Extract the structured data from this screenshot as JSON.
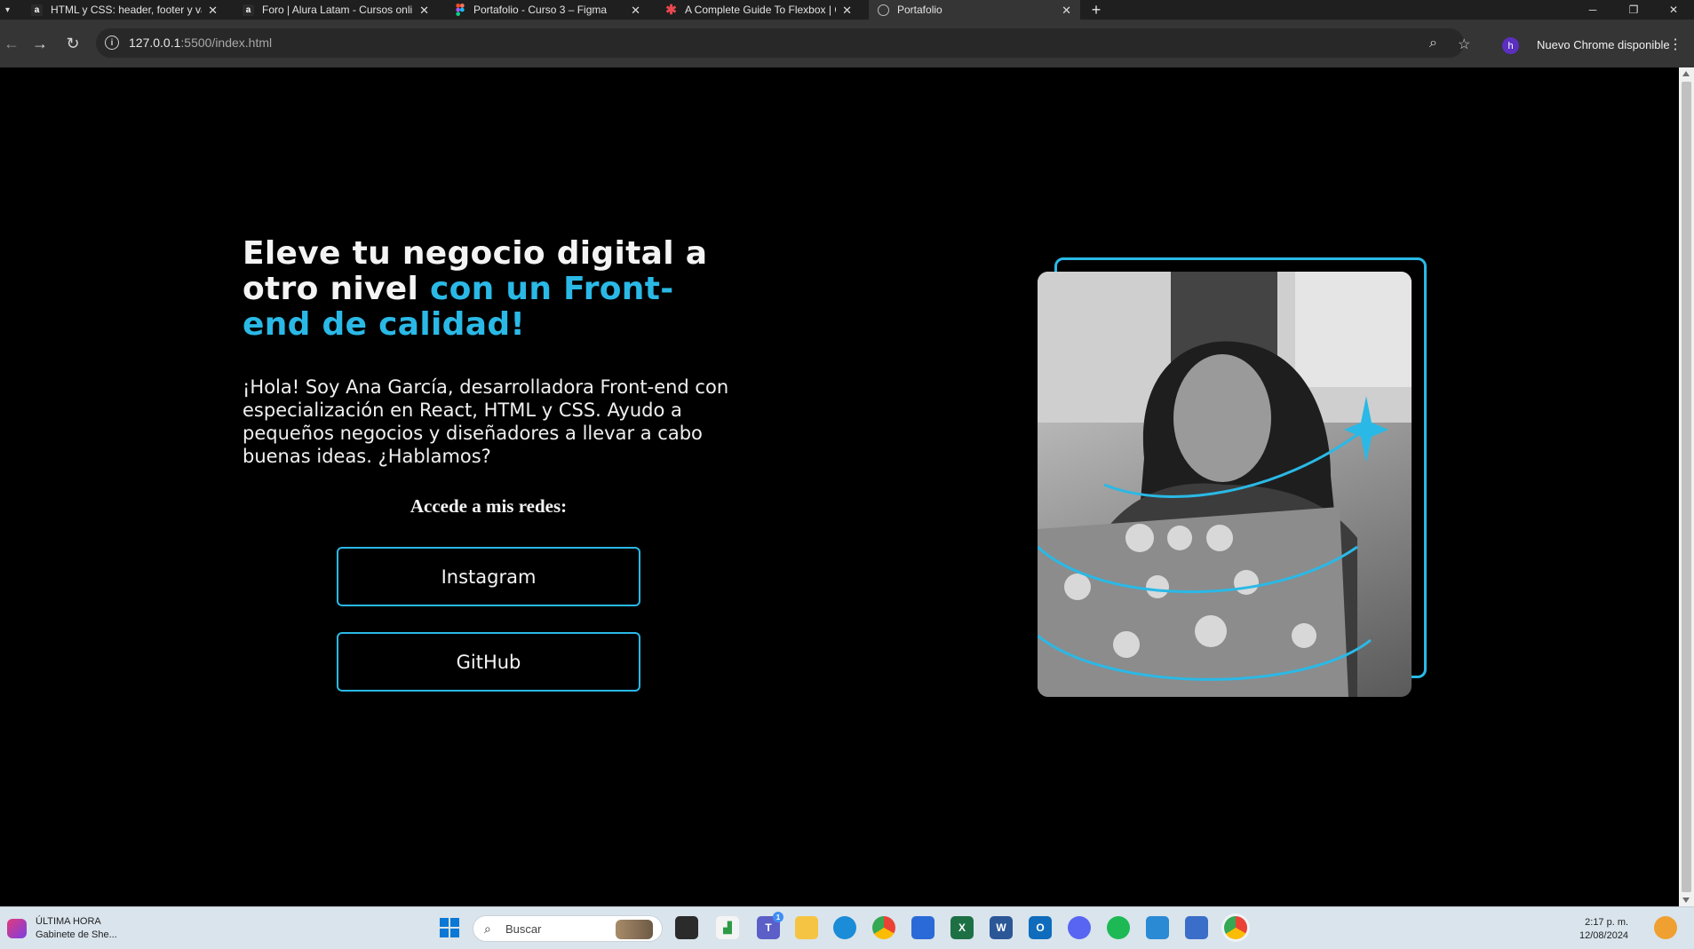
{
  "browser": {
    "tabs": [
      {
        "title": "HTML y CSS: header, footer y va",
        "favicon": "alura-icon",
        "active": false
      },
      {
        "title": "Foro | Alura Latam - Cursos onli",
        "favicon": "alura-icon",
        "active": false
      },
      {
        "title": "Portafolio - Curso 3 – Figma",
        "favicon": "figma-icon",
        "active": false
      },
      {
        "title": "A Complete Guide To Flexbox | C",
        "favicon": "css-tricks-icon",
        "active": false
      },
      {
        "title": "Portafolio",
        "favicon": "globe-icon",
        "active": true
      }
    ],
    "url_host": "127.0.0.1",
    "url_path": ":5500/index.html",
    "profile_initial": "h",
    "update_label": "Nuevo Chrome disponible"
  },
  "page": {
    "title_line1": "Eleve tu negocio digital a otro nivel",
    "title_accent": "con un Front-end de calidad!",
    "intro": "¡Hola! Soy Ana García, desarrolladora Front-end con especialización en React, HTML y CSS. Ayudo a pequeños negocios y diseñadores a llevar a cabo buenas ideas. ¿Hablamos?",
    "social_heading": "Accede a mis redes:",
    "buttons": {
      "instagram": "Instagram",
      "github": "GitHub"
    },
    "accent_color": "#2ab9e6"
  },
  "taskbar": {
    "news_title": "ÚLTIMA HORA",
    "news_subtitle": "Gabinete de She...",
    "search_placeholder": "Buscar",
    "teams_badge": "1",
    "time": "2:17 p. m.",
    "date": "12/08/2024"
  }
}
